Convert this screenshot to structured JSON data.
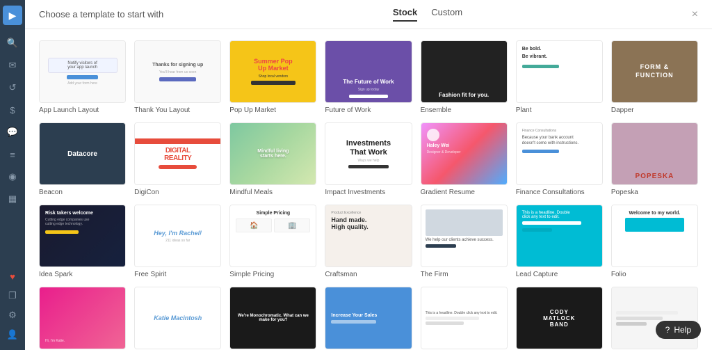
{
  "header": {
    "title": "Choose a template to start with",
    "tabs": [
      {
        "id": "stock",
        "label": "Stock",
        "active": true
      },
      {
        "id": "custom",
        "label": "Custom",
        "active": false
      }
    ],
    "close_label": "×"
  },
  "sidebar": {
    "logo": "▶",
    "icons": [
      {
        "id": "search",
        "glyph": "🔍"
      },
      {
        "id": "email",
        "glyph": "✉"
      },
      {
        "id": "refresh",
        "glyph": "↺"
      },
      {
        "id": "dollar",
        "glyph": "$"
      },
      {
        "id": "chat",
        "glyph": "💬"
      },
      {
        "id": "menu",
        "glyph": "≡"
      },
      {
        "id": "globe",
        "glyph": "◉"
      },
      {
        "id": "chart",
        "glyph": "▦"
      }
    ],
    "bottom_icons": [
      {
        "id": "heart",
        "glyph": "♥"
      },
      {
        "id": "layers",
        "glyph": "❐"
      },
      {
        "id": "settings",
        "glyph": "⚙"
      },
      {
        "id": "user",
        "glyph": "👤"
      }
    ]
  },
  "templates": {
    "row1": [
      {
        "id": "app-launch",
        "label": "App Launch Layout"
      },
      {
        "id": "thank-you",
        "label": "Thank You Layout"
      },
      {
        "id": "popup",
        "label": "Pop Up Market"
      },
      {
        "id": "future",
        "label": "Future of Work"
      },
      {
        "id": "ensemble",
        "label": "Ensemble"
      },
      {
        "id": "plant",
        "label": "Plant"
      },
      {
        "id": "dapper",
        "label": "Dapper"
      }
    ],
    "row2": [
      {
        "id": "beacon",
        "label": "Beacon"
      },
      {
        "id": "digicon",
        "label": "DigiCon"
      },
      {
        "id": "mindful",
        "label": "Mindful Meals"
      },
      {
        "id": "impact",
        "label": "Impact Investments"
      },
      {
        "id": "gradient",
        "label": "Gradient Resume"
      },
      {
        "id": "finance",
        "label": "Finance Consultations"
      },
      {
        "id": "popeska",
        "label": "Popeska"
      }
    ],
    "row3": [
      {
        "id": "ideaspark",
        "label": "Idea Spark"
      },
      {
        "id": "freespirit",
        "label": "Free Spirit"
      },
      {
        "id": "simplepricing",
        "label": "Simple Pricing"
      },
      {
        "id": "craftsman",
        "label": "Craftsman"
      },
      {
        "id": "firm",
        "label": "The Firm"
      },
      {
        "id": "leadcapture",
        "label": "Lead Capture"
      },
      {
        "id": "folio",
        "label": "Folio"
      }
    ],
    "row4": [
      {
        "id": "row4a",
        "label": ""
      },
      {
        "id": "row4b",
        "label": ""
      },
      {
        "id": "row4c",
        "label": ""
      },
      {
        "id": "row4d",
        "label": ""
      },
      {
        "id": "row4e",
        "label": ""
      },
      {
        "id": "row4f",
        "label": ""
      },
      {
        "id": "row4g",
        "label": ""
      }
    ]
  },
  "help_button": {
    "label": "Help"
  },
  "impact_text": {
    "line1": "Investments",
    "line2": "That Work"
  },
  "dapper_text": "FORM & FUNCTION",
  "ensemble_text": "Fashion fit for you.",
  "plant_text_1": "Be bold.",
  "plant_text_2": "Be vibrant.",
  "beacon_text": "Datacore",
  "digicon_text": "DIGITAL REALITY",
  "mindful_text": "Mindful living starts here.",
  "popeska_text": "POPESKA",
  "future_text": "The Future of Work",
  "popup_text_1": "Summer Pop",
  "popup_text_2": "Up Market",
  "craftsman_text": "Hand made. High quality.",
  "firm_text": "We help our clients achieve success.",
  "freespirit_text": "Hey, I'm Rachel!",
  "ideaspark_text": "Risk takers welcome",
  "row4c_text": "We're Monochromatic. What can we make for you?",
  "row4d_text": "Increase Your Sales",
  "row4f_text": "CODY MATLOCK BAND"
}
